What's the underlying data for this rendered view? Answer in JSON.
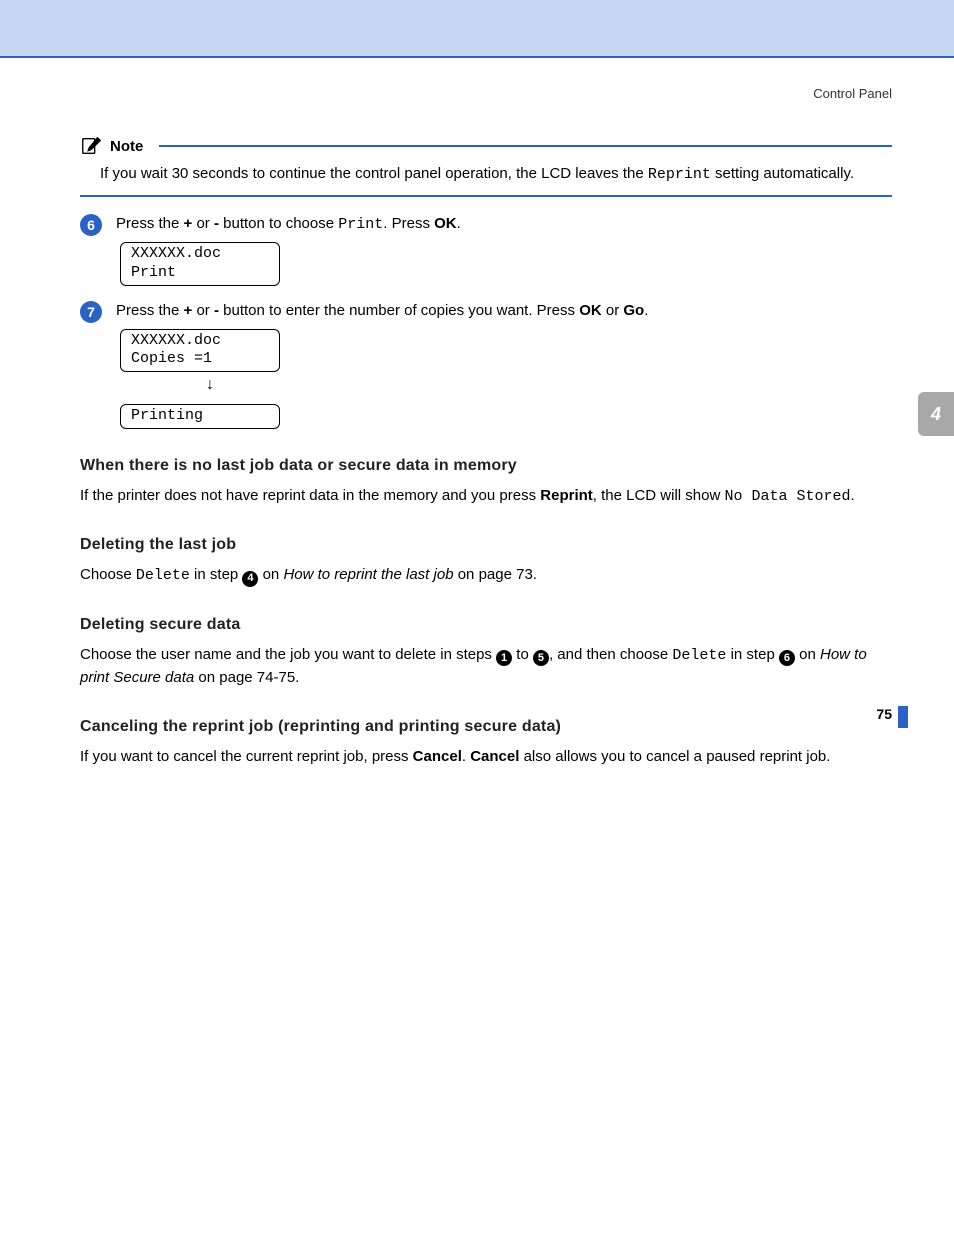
{
  "header": {
    "section": "Control Panel"
  },
  "side_tab": "4",
  "note": {
    "title": "Note",
    "body_pre": "If you wait 30 seconds to continue the control panel operation, the LCD leaves the ",
    "body_mono": "Reprint",
    "body_post": " setting automatically."
  },
  "step6": {
    "num": "6",
    "t1": "Press the ",
    "b1": "+",
    "t2": " or ",
    "b2": "-",
    "t3": " button to choose ",
    "mono": "Print",
    "t4": ". Press ",
    "b3": "OK",
    "t5": ".",
    "lcd": "XXXXXX.doc\nPrint"
  },
  "step7": {
    "num": "7",
    "t1": "Press the ",
    "b1": "+",
    "t2": " or ",
    "b2": "-",
    "t3": " button to enter the number of copies you want. Press ",
    "b3": "OK",
    "t4": " or ",
    "b4": "Go",
    "t5": ".",
    "lcd1": "XXXXXX.doc\nCopies =1",
    "arrow": "↓",
    "lcd2": "Printing"
  },
  "sec1": {
    "heading": "When there is no last job data or secure data in memory",
    "p_pre": "If the printer does not have reprint data in the memory and you press ",
    "p_bold": "Reprint",
    "p_mid": ", the LCD will show ",
    "p_mono": "No Data Stored",
    "p_post": "."
  },
  "sec2": {
    "heading": "Deleting the last job",
    "p_pre": "Choose ",
    "p_mono": "Delete",
    "p_mid": " in step ",
    "badge": "4",
    "p_on": " on ",
    "p_italic": "How to reprint the last job",
    "p_post": " on page 73."
  },
  "sec3": {
    "heading": "Deleting secure data",
    "p_pre": "Choose the user name and the job you want to delete in steps ",
    "badge1": "1",
    "p_to": " to ",
    "badge5": "5",
    "p_mid": ", and then choose ",
    "p_mono": "Delete",
    "p_in": " in step ",
    "badge6": "6",
    "p_on": " on ",
    "p_italic": "How to print Secure data",
    "p_post": " on page 74-75."
  },
  "sec4": {
    "heading": "Canceling the reprint job (reprinting and printing secure data)",
    "p_pre": "If you want to cancel the current reprint job, press ",
    "b1": "Cancel",
    "p_mid": ". ",
    "b2": "Cancel",
    "p_post": " also allows you to cancel a paused reprint job."
  },
  "page_number": "75"
}
